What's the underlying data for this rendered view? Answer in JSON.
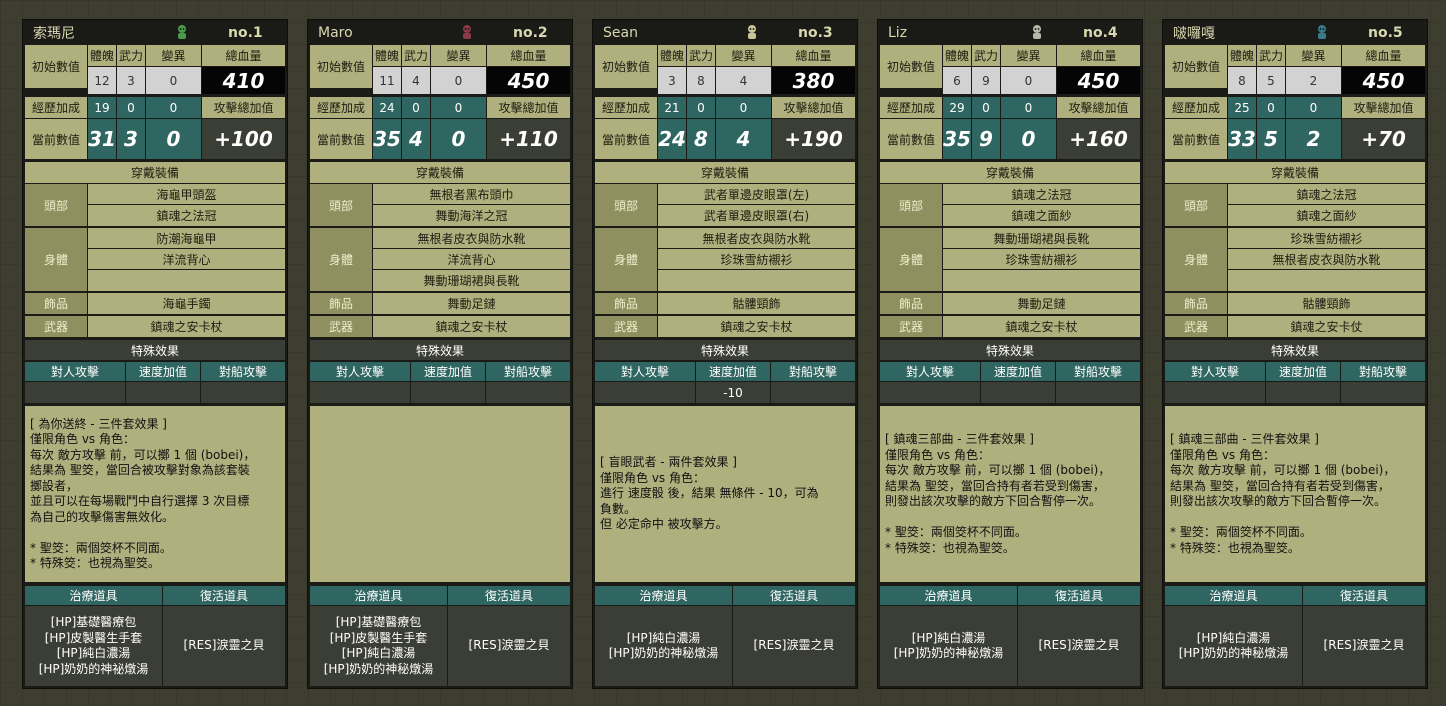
{
  "labels": {
    "tizhi": "體魄",
    "wuli": "武力",
    "bianyi": "變異",
    "hp_total": "總血量",
    "initial": "初始數值",
    "exp_bonus": "經歷加成",
    "atk_bonus": "攻擊總加值",
    "current": "當前數值",
    "equipment": "穿戴裝備",
    "head": "頭部",
    "body": "身體",
    "accessory": "飾品",
    "weapon": "武器",
    "special": "特殊效果",
    "vs_person": "對人攻擊",
    "speed_bonus": "速度加值",
    "vs_ship": "對船攻擊",
    "heal_items": "治療道具",
    "revive_items": "復活道具"
  },
  "cards": [
    {
      "name": "索瑪尼",
      "no": "no.1",
      "avatar_color": "#4a9a4a",
      "initial": [
        "12",
        "3",
        "0"
      ],
      "hp": "410",
      "exp": [
        "19",
        "0",
        "0"
      ],
      "current": [
        "31",
        "3",
        "0"
      ],
      "atk_total": "+100",
      "head": [
        "海龜甲頭盔",
        "鎮魂之法冠"
      ],
      "body": [
        "防潮海龜甲",
        "洋流背心",
        ""
      ],
      "accessory": "海龜手鐲",
      "weapon": "鎮魂之安卡杖",
      "speed": "",
      "desc": "[ 為你送終 - 三件套效果 ]\n僅限角色 vs 角色：\n每次 敵方攻擊 前，可以擲 1 個 (bobei)，\n結果為 聖筊，當回合被攻擊對象為該套裝\n擲設者，\n並且可以在每場戰鬥中自行選擇 3 次目標\n為自己的攻擊傷害無效化。\n\n* 聖筊：兩個筊杯不同面。\n* 特殊筊：也視為聖筊。",
      "heal": "[HP]基礎醫療包\n[HP]皮製醫生手套\n[HP]純白濃湯\n[HP]奶奶的神祕燉湯",
      "revive": "[RES]淚靈之貝"
    },
    {
      "name": "Maro",
      "no": "no.2",
      "avatar_color": "#8a3a4a",
      "initial": [
        "11",
        "4",
        "0"
      ],
      "hp": "450",
      "exp": [
        "24",
        "0",
        "0"
      ],
      "current": [
        "35",
        "4",
        "0"
      ],
      "atk_total": "+110",
      "head": [
        "無根者黑布頭巾",
        "舞動海洋之冠"
      ],
      "body": [
        "無根者皮衣與防水靴",
        "洋流背心",
        "舞動珊瑚裙與長靴"
      ],
      "accessory": "舞動足鏈",
      "weapon": "鎮魂之安卡杖",
      "speed": "",
      "desc": "",
      "heal": "[HP]基礎醫療包\n[HP]皮製醫生手套\n[HP]純白濃湯\n[HP]奶奶的神秘燉湯",
      "revive": "[RES]淚靈之貝"
    },
    {
      "name": "Sean",
      "no": "no.3",
      "avatar_color": "#c8c49a",
      "initial": [
        "3",
        "8",
        "4"
      ],
      "hp": "380",
      "exp": [
        "21",
        "0",
        "0"
      ],
      "current": [
        "24",
        "8",
        "4"
      ],
      "atk_total": "+190",
      "head": [
        "武者單邊皮眼罩(左)",
        "武者單邊皮眼罩(右)"
      ],
      "body": [
        "無根者皮衣與防水靴",
        "珍珠雪紡襯衫",
        ""
      ],
      "accessory": "骷髏頸飾",
      "weapon": "鎮魂之安卡杖",
      "speed": "-10",
      "desc": "[ 盲眼武者 - 兩件套效果 ]\n僅限角色 vs 角色：\n進行 速度骰 後，結果 無條件 - 10，可為\n負數。\n但 必定命中 被攻擊方。",
      "heal": "[HP]純白濃湯\n[HP]奶奶的神秘燉湯",
      "revive": "[RES]淚靈之貝"
    },
    {
      "name": "Liz",
      "no": "no.4",
      "avatar_color": "#b8b8a8",
      "initial": [
        "6",
        "9",
        "0"
      ],
      "hp": "450",
      "exp": [
        "29",
        "0",
        "0"
      ],
      "current": [
        "35",
        "9",
        "0"
      ],
      "atk_total": "+160",
      "head": [
        "鎮魂之法冠",
        "鎮魂之面紗"
      ],
      "body": [
        "舞動珊瑚裙與長靴",
        "珍珠雪紡襯衫",
        ""
      ],
      "accessory": "舞動足鏈",
      "weapon": "鎮魂之安卡杖",
      "speed": "",
      "desc": "[ 鎮魂三部曲 - 三件套效果 ]\n僅限角色 vs 角色：\n每次 敵方攻擊 前，可以擲 1 個 (bobei)，\n結果為 聖筊，當回合持有者若受到傷害，\n則發出該次攻擊的敵方下回合暫停一次。\n\n* 聖筊：兩個筊杯不同面。\n* 特殊筊：也視為聖筊。",
      "heal": "[HP]純白濃湯\n[HP]奶奶的神秘燉湯",
      "revive": "[RES]淚靈之貝"
    },
    {
      "name": "啵囉嘎",
      "no": "no.5",
      "avatar_color": "#3a7a8a",
      "initial": [
        "8",
        "5",
        "2"
      ],
      "hp": "450",
      "exp": [
        "25",
        "0",
        "0"
      ],
      "current": [
        "33",
        "5",
        "2"
      ],
      "atk_total": "+70",
      "head": [
        "鎮魂之法冠",
        "鎮魂之面紗"
      ],
      "body": [
        "珍珠雪紡襯衫",
        "無根者皮衣與防水靴",
        ""
      ],
      "accessory": "骷髏頸飾",
      "weapon": "鎮魂之安卡仗",
      "speed": "",
      "desc": "[ 鎮魂三部曲 - 三件套效果 ]\n僅限角色 vs 角色：\n每次 敵方攻擊 前，可以擲 1 個 (bobei)，\n結果為 聖筊，當回合持有者若受到傷害，\n則發出該次攻擊的敵方下回合暫停一次。\n\n* 聖筊：兩個筊杯不同面。\n* 特殊筊：也視為聖筊。",
      "heal": "[HP]純白濃湯\n[HP]奶奶的神秘燉湯",
      "revive": "[RES]淚靈之貝"
    }
  ]
}
